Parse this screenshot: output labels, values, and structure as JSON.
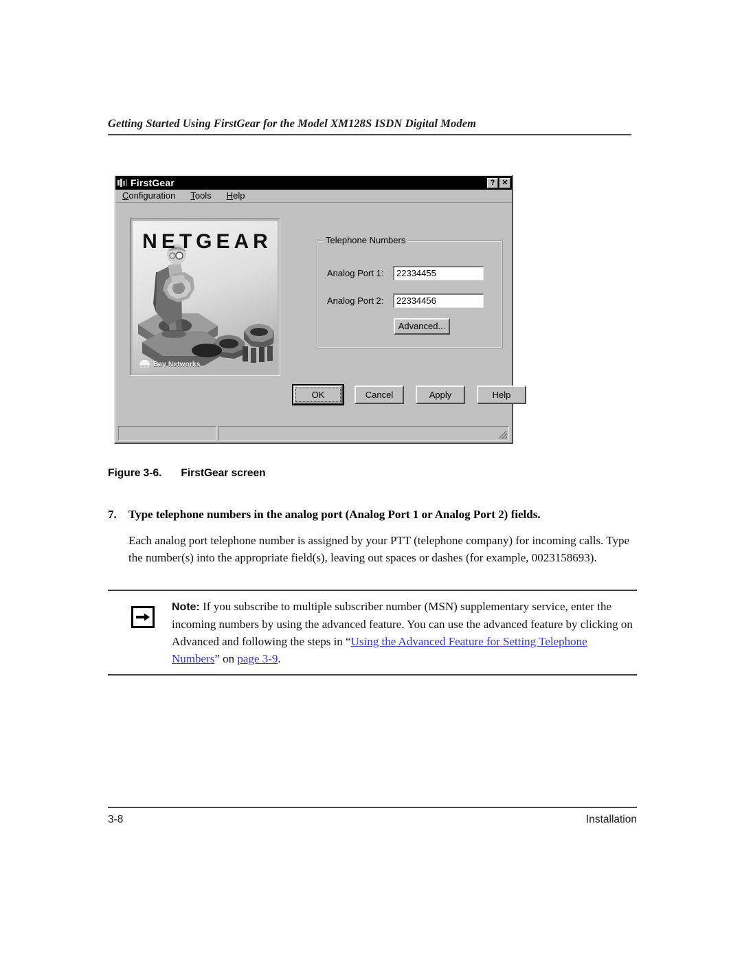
{
  "header": {
    "title": "Getting Started Using FirstGear for the Model XM128S ISDN Digital Modem"
  },
  "dialog": {
    "title": "FirstGear",
    "title_icon": "app-icon",
    "title_buttons": [
      {
        "name": "help",
        "label": "?"
      },
      {
        "name": "close",
        "label": "✕"
      }
    ],
    "menu": [
      {
        "label": "Configuration",
        "accelerator": "C"
      },
      {
        "label": "Tools",
        "accelerator": "T"
      },
      {
        "label": "Help",
        "accelerator": "H"
      }
    ],
    "splash": {
      "brand": "NETGEAR",
      "partner": "Bay Networks"
    },
    "group": {
      "legend": "Telephone Numbers",
      "fields": [
        {
          "label": "Analog Port 1:",
          "value": "22334455",
          "placeholder": ""
        },
        {
          "label": "Analog Port 2:",
          "value": "22334456",
          "placeholder": ""
        }
      ],
      "advanced_button": "Advanced..."
    },
    "actions": [
      {
        "label": "OK",
        "default": true
      },
      {
        "label": "Cancel",
        "default": false
      },
      {
        "label": "Apply",
        "default": false
      },
      {
        "label": "Help",
        "default": false
      }
    ],
    "status": {
      "pane1": "",
      "pane2": ""
    }
  },
  "figure": {
    "number": "Figure 3-6.",
    "caption": "FirstGear screen"
  },
  "step": {
    "number": "7.",
    "text": "Type telephone numbers in the analog port (Analog Port 1 or Analog Port 2) fields."
  },
  "body": {
    "paragraph": "Each analog port telephone number is assigned by your PTT (telephone company) for incoming calls. Type the number(s) into the appropriate field(s), leaving out spaces or dashes (for example, 0023158693)."
  },
  "note": {
    "icon": "right-arrow-icon",
    "label": "Note:",
    "text_before": " If you subscribe to multiple subscriber number (MSN) supplementary service, enter the incoming numbers by using the advanced feature. You can use the advanced feature by clicking on Advanced and following the steps in ",
    "quote_open": "“",
    "link_title": "Using the Advanced Feature for Setting Telephone Numbers",
    "quote_close": "”",
    "text_middle": " on ",
    "link_page": "page 3-9",
    "text_after": "."
  },
  "footer": {
    "page_number": "3-8",
    "section": "Installation"
  },
  "colors": {
    "link": "#3333CC",
    "dialog_face": "#C0C0C0",
    "titlebar": "#000000",
    "rule": "#4A4A4A"
  }
}
